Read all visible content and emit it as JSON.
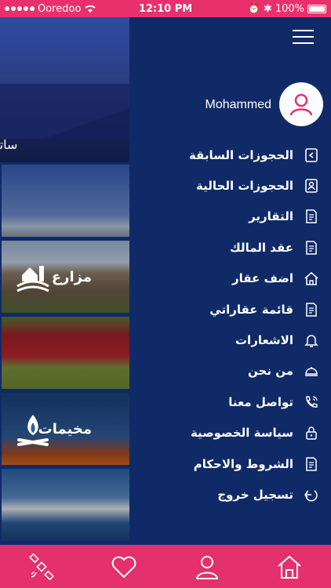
{
  "status_bar": {
    "carrier": "Ooredoo",
    "time": "12:10 PM",
    "battery": "100%"
  },
  "background": {
    "hero_title": "ساتنا",
    "cards": [
      {
        "label": ""
      },
      {
        "label": "مزارع"
      },
      {
        "label": ""
      },
      {
        "label": "مخيمات"
      },
      {
        "label": ""
      }
    ]
  },
  "drawer": {
    "user_name": "Mohammed",
    "menu_items": [
      {
        "label": "الحجوزات السابقة",
        "icon": "previous-bookings-icon"
      },
      {
        "label": "الحجوزات الحالية",
        "icon": "current-bookings-icon"
      },
      {
        "label": "التقارير",
        "icon": "reports-icon"
      },
      {
        "label": "عقد المالك",
        "icon": "owner-contract-icon"
      },
      {
        "label": "اضف عقار",
        "icon": "home-add-icon"
      },
      {
        "label": "قائمة عقاراتي",
        "icon": "my-properties-icon"
      },
      {
        "label": "الاشعارات",
        "icon": "bell-icon"
      },
      {
        "label": "من نحن",
        "icon": "cloche-icon"
      },
      {
        "label": "تواصل معنا",
        "icon": "phone-icon"
      },
      {
        "label": "سياسة الخصوصية",
        "icon": "lock-icon"
      },
      {
        "label": "الشروط والاحكام",
        "icon": "terms-icon"
      },
      {
        "label": "تسجيل خروج",
        "icon": "logout-icon"
      }
    ]
  },
  "tabbar": {
    "tabs": [
      "satellite-icon",
      "heart-icon",
      "user-icon",
      "home-icon"
    ]
  },
  "colors": {
    "primary_pink": "#e4306c",
    "navy": "#0f2a66"
  }
}
